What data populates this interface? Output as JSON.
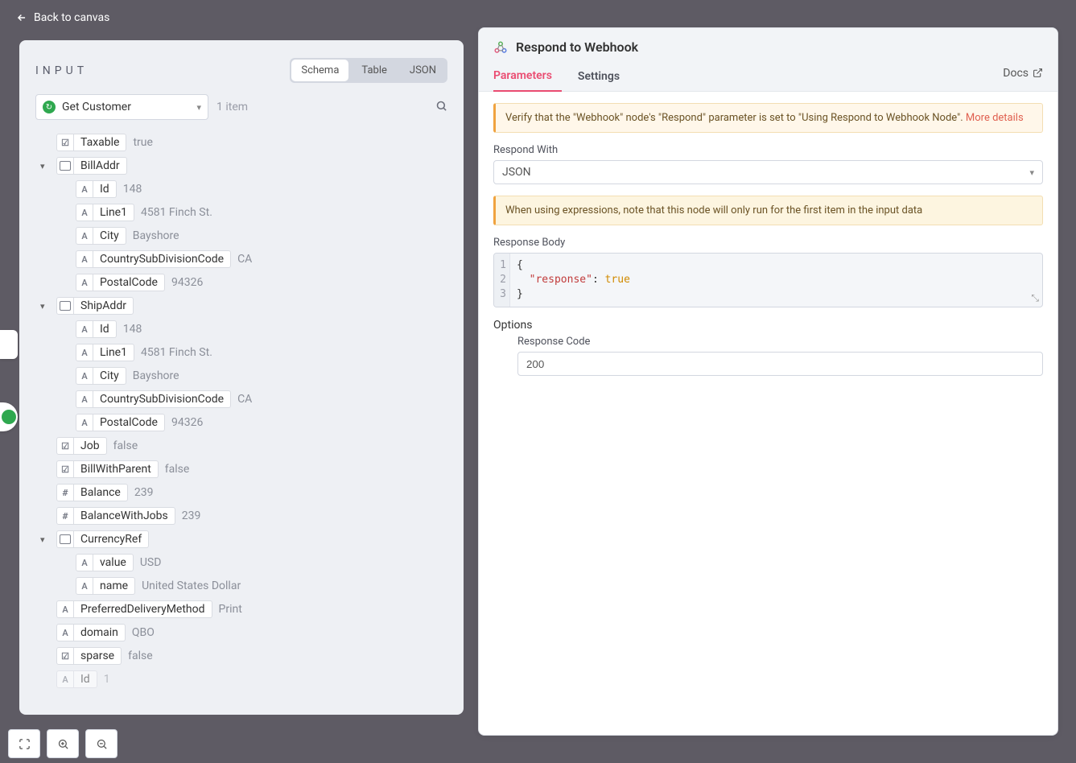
{
  "back_label": "Back to canvas",
  "input": {
    "title": "INPUT",
    "tabs": {
      "schema": "Schema",
      "table": "Table",
      "json": "JSON"
    },
    "source": "Get Customer",
    "item_count": "1 item",
    "tree": {
      "taxable": {
        "key": "Taxable",
        "value": "true"
      },
      "billaddr": {
        "key": "BillAddr",
        "id": {
          "key": "Id",
          "value": "148"
        },
        "line1": {
          "key": "Line1",
          "value": "4581 Finch St."
        },
        "city": {
          "key": "City",
          "value": "Bayshore"
        },
        "csd": {
          "key": "CountrySubDivisionCode",
          "value": "CA"
        },
        "postal": {
          "key": "PostalCode",
          "value": "94326"
        }
      },
      "shipaddr": {
        "key": "ShipAddr",
        "id": {
          "key": "Id",
          "value": "148"
        },
        "line1": {
          "key": "Line1",
          "value": "4581 Finch St."
        },
        "city": {
          "key": "City",
          "value": "Bayshore"
        },
        "csd": {
          "key": "CountrySubDivisionCode",
          "value": "CA"
        },
        "postal": {
          "key": "PostalCode",
          "value": "94326"
        }
      },
      "job": {
        "key": "Job",
        "value": "false"
      },
      "bwp": {
        "key": "BillWithParent",
        "value": "false"
      },
      "balance": {
        "key": "Balance",
        "value": "239"
      },
      "bwj": {
        "key": "BalanceWithJobs",
        "value": "239"
      },
      "curref": {
        "key": "CurrencyRef",
        "value": {
          "key": "value",
          "value": "USD"
        },
        "name": {
          "key": "name",
          "value": "United States Dollar"
        }
      },
      "pdm": {
        "key": "PreferredDeliveryMethod",
        "value": "Print"
      },
      "domain": {
        "key": "domain",
        "value": "QBO"
      },
      "sparse": {
        "key": "sparse",
        "value": "false"
      },
      "id2": {
        "key": "Id",
        "value": "1"
      }
    }
  },
  "node": {
    "title": "Respond to Webhook",
    "tabs": {
      "parameters": "Parameters",
      "settings": "Settings"
    },
    "docs": "Docs",
    "alert1_text": "Verify that the \"Webhook\" node's \"Respond\" parameter is set to \"Using Respond to Webhook Node\". ",
    "alert1_link": "More details",
    "respond_with_label": "Respond With",
    "respond_with_value": "JSON",
    "alert2_text": "When using expressions, note that this node will only run for the first item in the input data",
    "response_body_label": "Response Body",
    "code": {
      "l1": "{",
      "l2a": "\"response\"",
      "l2b": ": ",
      "l2c": "true",
      "l3": "}"
    },
    "options_label": "Options",
    "response_code_label": "Response Code",
    "response_code_value": "200"
  }
}
